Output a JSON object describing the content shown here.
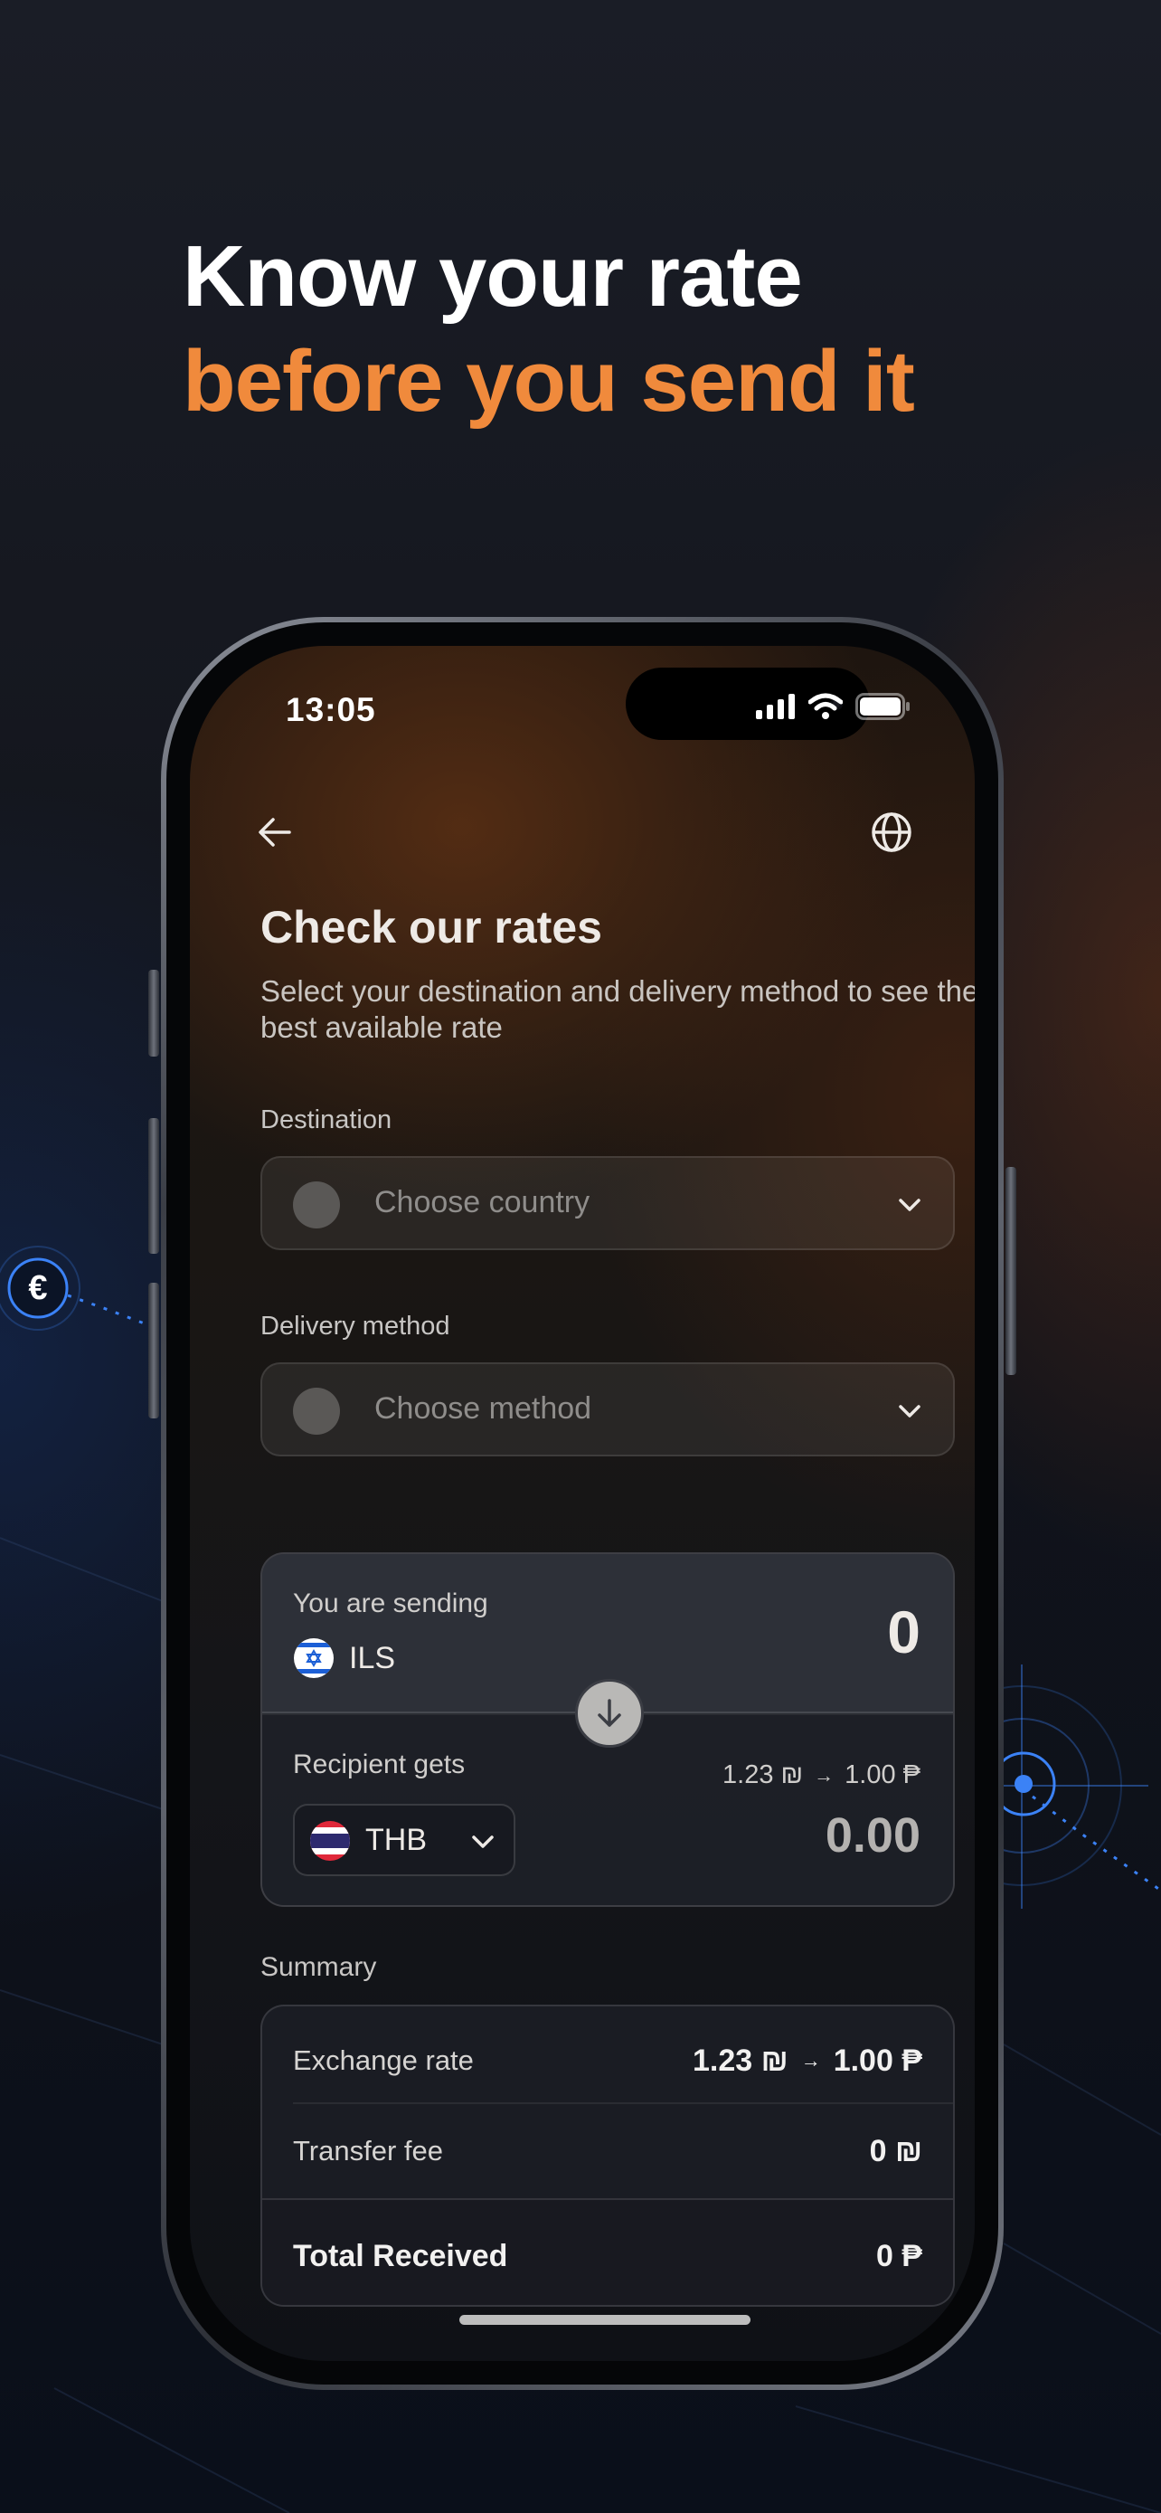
{
  "headline": {
    "line1": "Know your rate",
    "line2": "before you send it"
  },
  "colors": {
    "accent": "#f08a3c",
    "deco_blue": "#3b82f6"
  },
  "deco": {
    "euro_symbol": "€"
  },
  "status_bar": {
    "time": "13:05",
    "icons": [
      "cellular-signal-icon",
      "wifi-icon",
      "battery-icon"
    ]
  },
  "nav": {
    "back_icon": "arrow-left-icon",
    "language_icon": "globe-icon"
  },
  "page": {
    "title": "Check our rates",
    "subtitle": "Select your destination and delivery method to see the best available rate"
  },
  "destination": {
    "label": "Destination",
    "placeholder": "Choose country"
  },
  "delivery": {
    "label": "Delivery method",
    "placeholder": "Choose method"
  },
  "converter": {
    "sending_label": "You are sending",
    "sending_currency": "ILS",
    "sending_amount": "0",
    "recipient_label": "Recipient gets",
    "recipient_currency": "THB",
    "rate_from": "1.23 ₪",
    "rate_arrow": "→",
    "rate_to": "1.00 ₱",
    "recipient_amount": "0.00"
  },
  "summary": {
    "label": "Summary",
    "exchange_rate_label": "Exchange rate",
    "exchange_rate_from": "1.23 ₪",
    "exchange_rate_arrow": "→",
    "exchange_rate_to": "1.00 ₱",
    "transfer_fee_label": "Transfer fee",
    "transfer_fee_value": "0 ₪",
    "total_label": "Total Received",
    "total_value": "0 ₱"
  }
}
